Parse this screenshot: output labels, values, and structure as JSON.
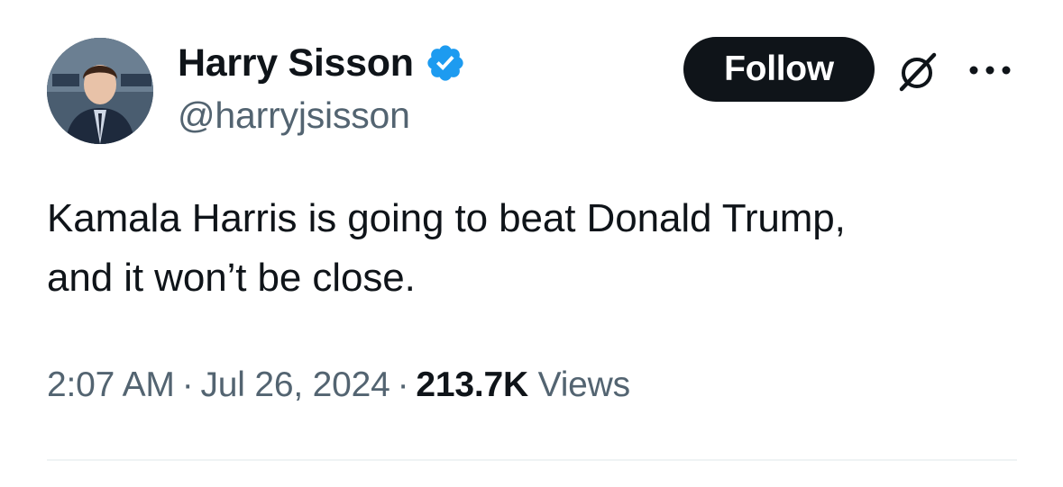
{
  "author": {
    "display_name": "Harry Sisson",
    "handle": "@harryjsisson",
    "verified": true,
    "verified_color": "#1d9bf0"
  },
  "actions": {
    "follow_label": "Follow",
    "grok_icon": "grok-icon",
    "more_icon": "more-horizontal-icon"
  },
  "tweet": {
    "text": "Kamala Harris is going to beat Donald Trump,\nand it won’t be close.",
    "time": "2:07 AM",
    "date": "Jul 26, 2024",
    "views_count": "213.7K",
    "views_label": "Views",
    "separator": "·"
  },
  "colors": {
    "text_primary": "#0f1419",
    "text_secondary": "#536471",
    "follow_bg": "#0f1419",
    "divider": "#eff3f4"
  }
}
